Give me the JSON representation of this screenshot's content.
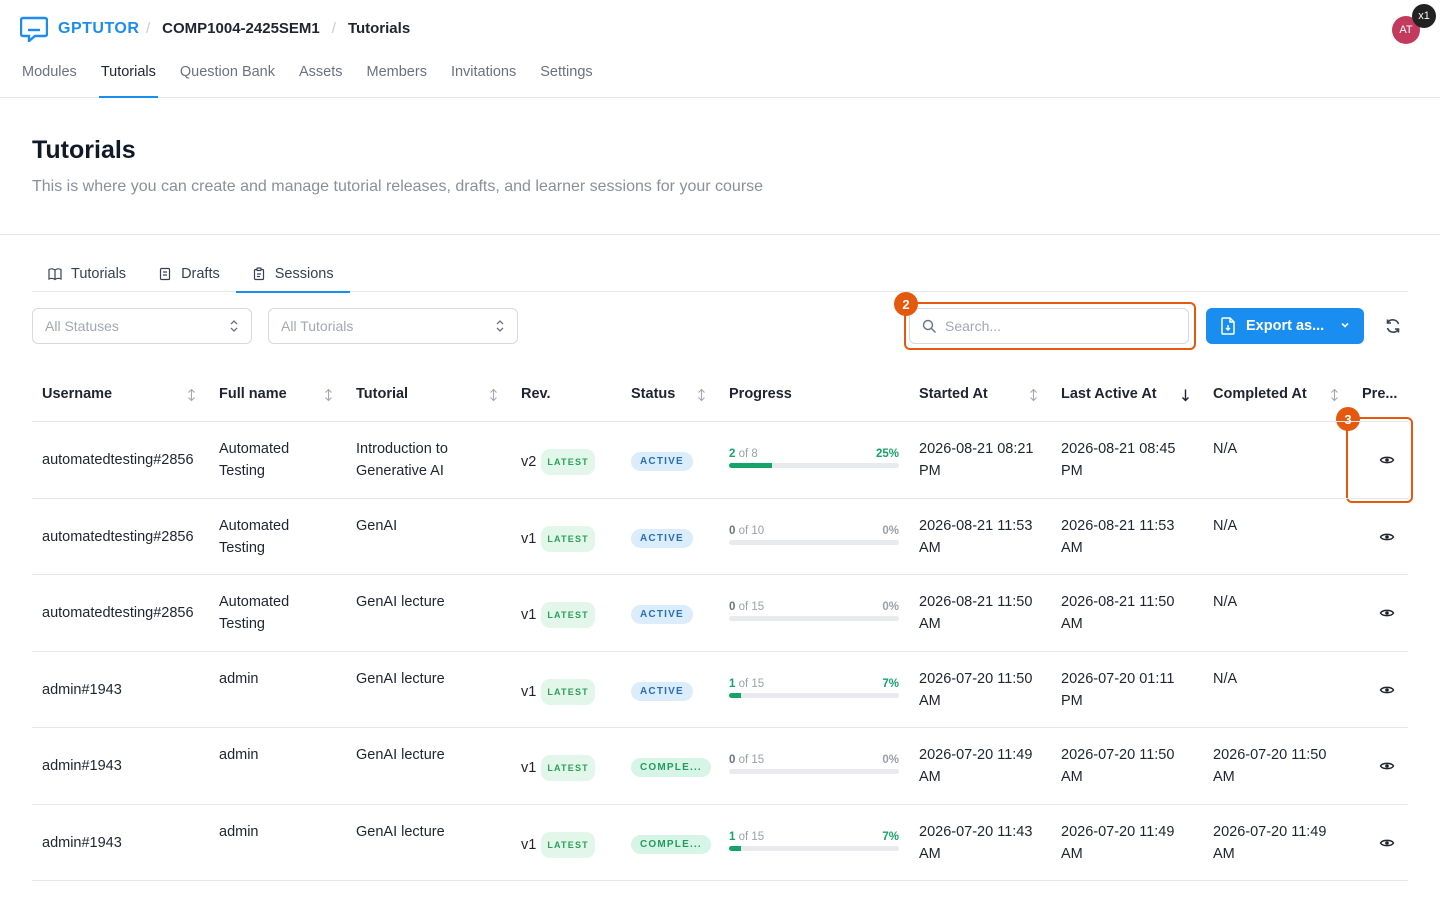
{
  "app": {
    "name": "GPTUTOR"
  },
  "breadcrumbs": [
    "COMP1004-2425SEM1",
    "Tutorials"
  ],
  "avatar": {
    "initials": "AT",
    "color": "#c23b5f"
  },
  "mini_badge": "x1",
  "main_nav": [
    "Modules",
    "Tutorials",
    "Question Bank",
    "Assets",
    "Members",
    "Invitations",
    "Settings"
  ],
  "main_nav_active": "Tutorials",
  "page": {
    "title": "Tutorials",
    "subtitle": "This is where you can create and manage tutorial releases, drafts, and learner sessions for your course"
  },
  "sub_tabs": [
    {
      "label": "Tutorials",
      "icon": "book-icon"
    },
    {
      "label": "Drafts",
      "icon": "draft-icon"
    },
    {
      "label": "Sessions",
      "icon": "clipboard-icon"
    }
  ],
  "sub_tab_active": "Sessions",
  "filters": {
    "status": {
      "value": "All Statuses"
    },
    "tutorial": {
      "value": "All Tutorials"
    },
    "search": {
      "placeholder": "Search..."
    },
    "export_label": "Export as..."
  },
  "annotations": [
    "2",
    "3"
  ],
  "table": {
    "columns": [
      "Username",
      "Full name",
      "Tutorial",
      "Rev.",
      "Status",
      "Progress",
      "Started At",
      "Last Active At",
      "Completed At",
      "Pre..."
    ],
    "rows": [
      {
        "username": "automatedtesting#2856",
        "full_name": "Automated Testing",
        "tutorial": "Introduction to Generative AI",
        "rev": "v2",
        "rev_badge": "LATEST",
        "status": "ACTIVE",
        "progress_done": "2",
        "progress_of": "of 8",
        "progress_pct": "25%",
        "progress_fraction": 0.25,
        "started": "2026-08-21 08:21 PM",
        "last_active": "2026-08-21 08:45 PM",
        "completed": "N/A"
      },
      {
        "username": "automatedtesting#2856",
        "full_name": "Automated Testing",
        "tutorial": "GenAI",
        "rev": "v1",
        "rev_badge": "LATEST",
        "status": "ACTIVE",
        "progress_done": "0",
        "progress_of": "of 10",
        "progress_pct": "0%",
        "progress_fraction": 0,
        "started": "2026-08-21 11:53 AM",
        "last_active": "2026-08-21 11:53 AM",
        "completed": "N/A"
      },
      {
        "username": "automatedtesting#2856",
        "full_name": "Automated Testing",
        "tutorial": "GenAI lecture",
        "rev": "v1",
        "rev_badge": "LATEST",
        "status": "ACTIVE",
        "progress_done": "0",
        "progress_of": "of 15",
        "progress_pct": "0%",
        "progress_fraction": 0,
        "started": "2026-08-21 11:50 AM",
        "last_active": "2026-08-21 11:50 AM",
        "completed": "N/A"
      },
      {
        "username": "admin#1943",
        "full_name": "admin",
        "tutorial": "GenAI lecture",
        "rev": "v1",
        "rev_badge": "LATEST",
        "status": "ACTIVE",
        "progress_done": "1",
        "progress_of": "of 15",
        "progress_pct": "7%",
        "progress_fraction": 0.07,
        "started": "2026-07-20 11:50 AM",
        "last_active": "2026-07-20 01:11 PM",
        "completed": "N/A"
      },
      {
        "username": "admin#1943",
        "full_name": "admin",
        "tutorial": "GenAI lecture",
        "rev": "v1",
        "rev_badge": "LATEST",
        "status": "COMPLE...",
        "progress_done": "0",
        "progress_of": "of 15",
        "progress_pct": "0%",
        "progress_fraction": 0,
        "started": "2026-07-20 11:49 AM",
        "last_active": "2026-07-20 11:50 AM",
        "completed": "2026-07-20 11:50 AM"
      },
      {
        "username": "admin#1943",
        "full_name": "admin",
        "tutorial": "GenAI lecture",
        "rev": "v1",
        "rev_badge": "LATEST",
        "status": "COMPLE...",
        "progress_done": "1",
        "progress_of": "of 15",
        "progress_pct": "7%",
        "progress_fraction": 0.07,
        "started": "2026-07-20 11:43 AM",
        "last_active": "2026-07-20 11:49 AM",
        "completed": "2026-07-20 11:49 AM"
      }
    ]
  },
  "colors": {
    "accent": "#1a8ef0",
    "annotation": "#e5590f",
    "progress": "#16a36a"
  }
}
